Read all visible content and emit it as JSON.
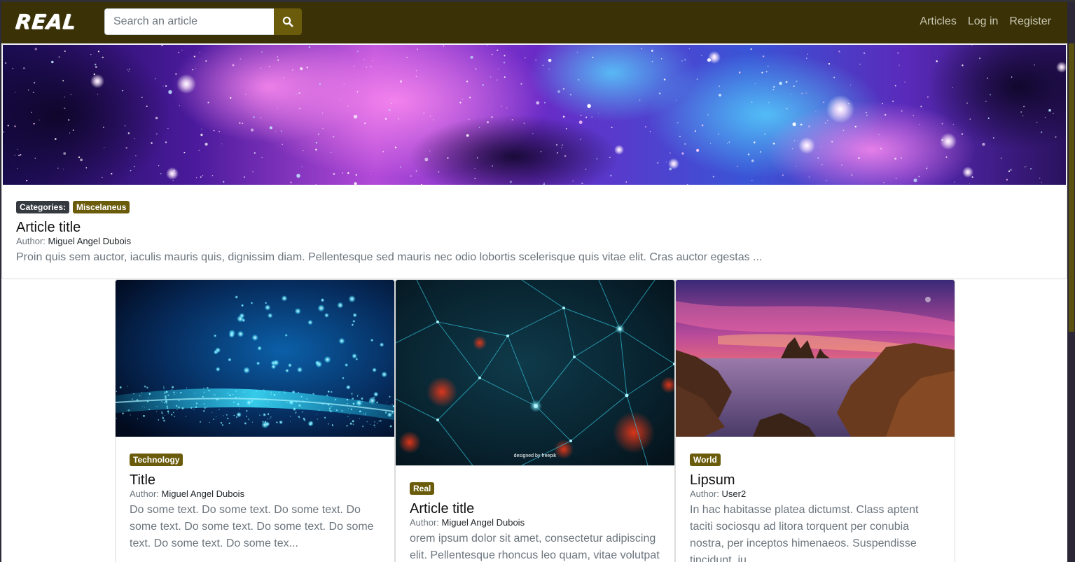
{
  "navbar": {
    "logo_text": "REAL",
    "search_placeholder": "Search an article",
    "search_icon": "search-icon",
    "links": [
      "Articles",
      "Log in",
      "Register"
    ]
  },
  "featured": {
    "categories_label": "Categories:",
    "category": "Miscelaneus",
    "title": "Article title",
    "author_label": "Author:",
    "author": "Miguel Angel Dubois",
    "excerpt": "Proin quis sem auctor, iaculis mauris quis, dignissim diam. Pellentesque sed mauris nec odio lobortis scelerisque quis vitae elit. Cras auctor egestas ..."
  },
  "cards": [
    {
      "category": "Technology",
      "title": "Title",
      "author_label": "Author:",
      "author": "Miguel Angel Dubois",
      "excerpt": "Do some text. Do some text. Do some text. Do some text. Do some text. Do some text. Do some text. Do some text. Do some tex..."
    },
    {
      "category": "Real",
      "title": "Article title",
      "author_label": "Author:",
      "author": "Miguel Angel Dubois",
      "excerpt": "orem ipsum dolor sit amet, consectetur adipiscing elit. Pellentesque rhoncus leo quam, vitae volutpat",
      "watermark": "designed by freepik"
    },
    {
      "category": "World",
      "title": "Lipsum",
      "author_label": "Author:",
      "author": "User2",
      "excerpt": "In hac habitasse platea dictumst. Class aptent taciti sociosqu ad litora torquent per conubia nostra, per inceptos himenaeos. Suspendisse tincidunt, iu..."
    }
  ],
  "colors": {
    "navbar_bg": "#3a3206",
    "accent": "#6b5c0c",
    "badge_dark": "#343a40"
  }
}
